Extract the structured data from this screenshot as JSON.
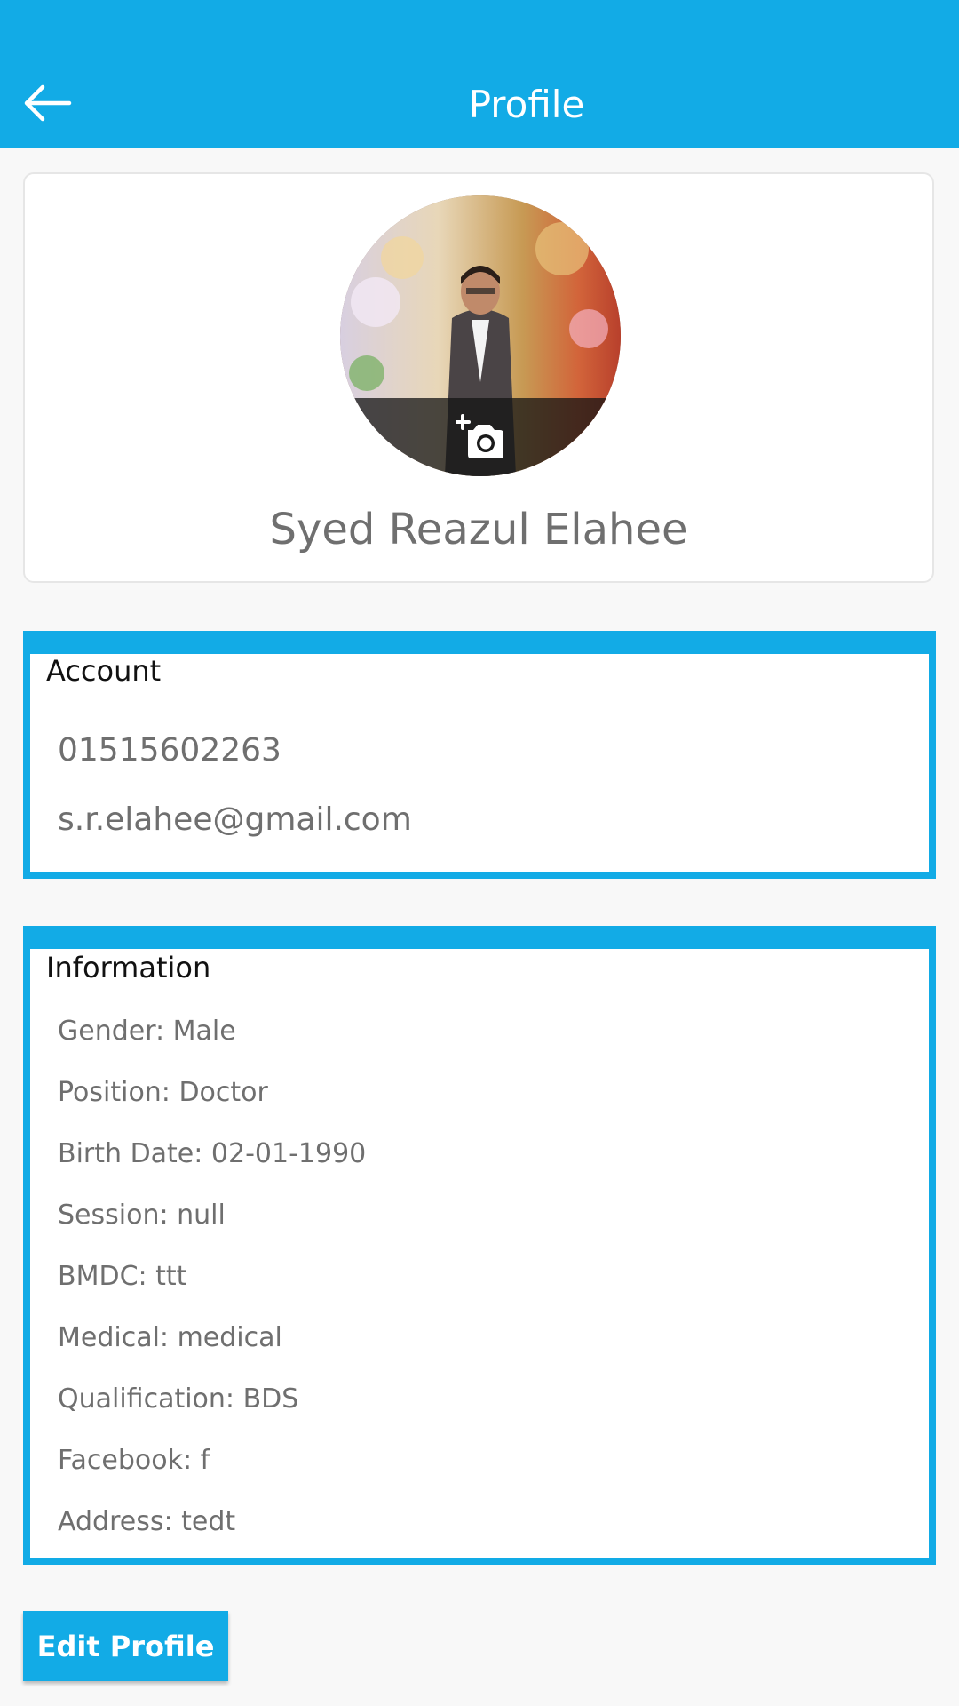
{
  "app_bar": {
    "title": "Profile",
    "background": "#12abe6",
    "back_icon": "arrow-left-icon"
  },
  "profile": {
    "name": "Syed Reazul Elahee",
    "avatar_icon": "add-photo-camera-icon"
  },
  "account": {
    "heading": "Account",
    "phone": "01515602263",
    "email": "s.r.elahee@gmail.com"
  },
  "information": {
    "heading": "Information",
    "items": [
      "Gender: Male",
      "Position: Doctor",
      "Birth Date: 02-01-1990",
      "Session: null",
      "BMDC: ttt",
      "Medical: medical",
      "Qualification: BDS",
      "Facebook: f",
      "Address: tedt"
    ]
  },
  "actions": {
    "edit_profile_label": "Edit Profile"
  }
}
